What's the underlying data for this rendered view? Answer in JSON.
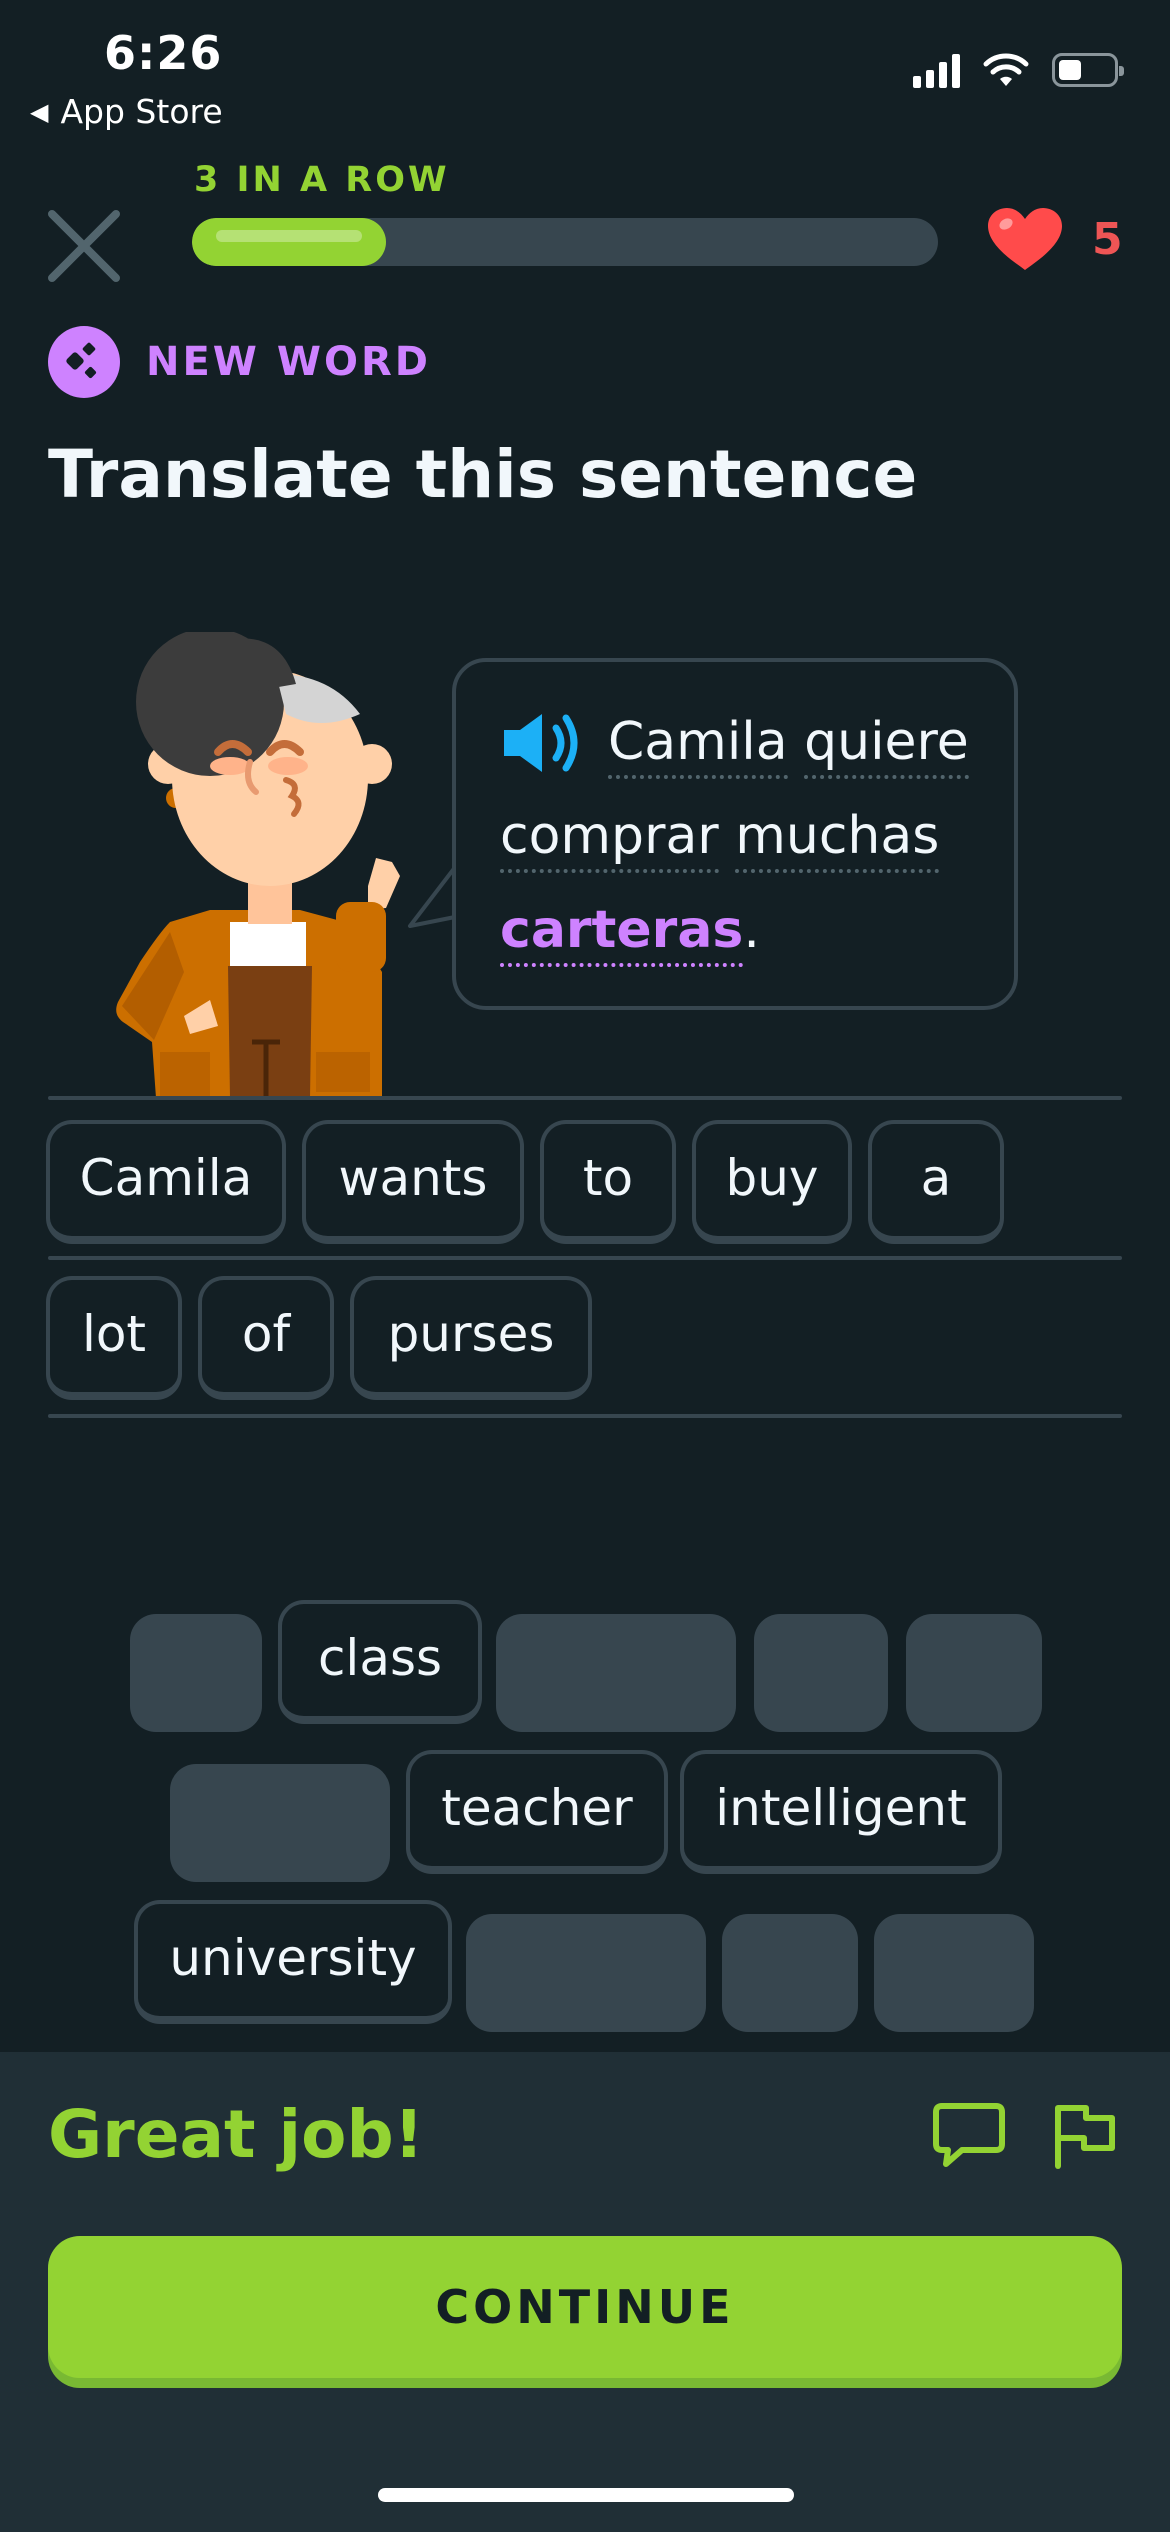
{
  "status_bar": {
    "time": "6:26",
    "back_label": "App Store"
  },
  "header": {
    "streak_label": "3 IN A ROW",
    "progress": 0.26,
    "hearts": "5",
    "accent": "#93d333",
    "heart_color": "#ff4b4b"
  },
  "challenge": {
    "badge": "NEW WORD",
    "badge_color": "#ce82ff",
    "instruction": "Translate this sentence",
    "prompt_words": [
      "Camila",
      "quiere",
      "comprar",
      "muchas",
      "carteras"
    ],
    "prompt_period": ".",
    "new_word": "carteras"
  },
  "answer": {
    "row1": [
      "Camila",
      "wants",
      "to",
      "buy",
      "a"
    ],
    "row2": [
      "lot",
      "of",
      "purses"
    ]
  },
  "word_bank": [
    "class",
    "teacher",
    "intelligent",
    "university"
  ],
  "feedback": {
    "message": "Great job!",
    "continue_label": "CONTINUE",
    "icons": [
      "comment-icon",
      "report-flag-icon"
    ]
  }
}
